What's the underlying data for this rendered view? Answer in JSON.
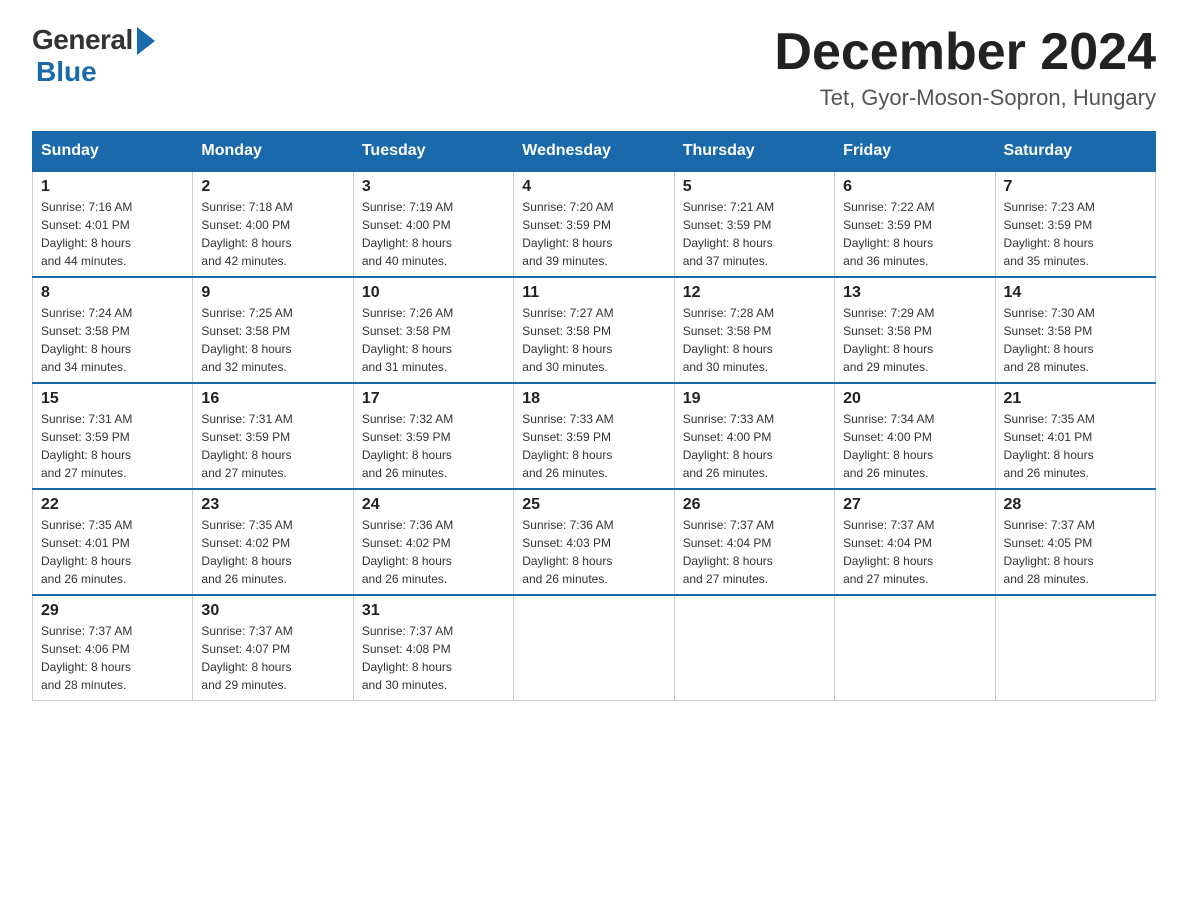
{
  "logo": {
    "general": "General",
    "blue": "Blue"
  },
  "header": {
    "month": "December 2024",
    "location": "Tet, Gyor-Moson-Sopron, Hungary"
  },
  "days_of_week": [
    "Sunday",
    "Monday",
    "Tuesday",
    "Wednesday",
    "Thursday",
    "Friday",
    "Saturday"
  ],
  "weeks": [
    [
      {
        "day": "1",
        "sunrise": "7:16 AM",
        "sunset": "4:01 PM",
        "daylight": "8 hours and 44 minutes."
      },
      {
        "day": "2",
        "sunrise": "7:18 AM",
        "sunset": "4:00 PM",
        "daylight": "8 hours and 42 minutes."
      },
      {
        "day": "3",
        "sunrise": "7:19 AM",
        "sunset": "4:00 PM",
        "daylight": "8 hours and 40 minutes."
      },
      {
        "day": "4",
        "sunrise": "7:20 AM",
        "sunset": "3:59 PM",
        "daylight": "8 hours and 39 minutes."
      },
      {
        "day": "5",
        "sunrise": "7:21 AM",
        "sunset": "3:59 PM",
        "daylight": "8 hours and 37 minutes."
      },
      {
        "day": "6",
        "sunrise": "7:22 AM",
        "sunset": "3:59 PM",
        "daylight": "8 hours and 36 minutes."
      },
      {
        "day": "7",
        "sunrise": "7:23 AM",
        "sunset": "3:59 PM",
        "daylight": "8 hours and 35 minutes."
      }
    ],
    [
      {
        "day": "8",
        "sunrise": "7:24 AM",
        "sunset": "3:58 PM",
        "daylight": "8 hours and 34 minutes."
      },
      {
        "day": "9",
        "sunrise": "7:25 AM",
        "sunset": "3:58 PM",
        "daylight": "8 hours and 32 minutes."
      },
      {
        "day": "10",
        "sunrise": "7:26 AM",
        "sunset": "3:58 PM",
        "daylight": "8 hours and 31 minutes."
      },
      {
        "day": "11",
        "sunrise": "7:27 AM",
        "sunset": "3:58 PM",
        "daylight": "8 hours and 30 minutes."
      },
      {
        "day": "12",
        "sunrise": "7:28 AM",
        "sunset": "3:58 PM",
        "daylight": "8 hours and 30 minutes."
      },
      {
        "day": "13",
        "sunrise": "7:29 AM",
        "sunset": "3:58 PM",
        "daylight": "8 hours and 29 minutes."
      },
      {
        "day": "14",
        "sunrise": "7:30 AM",
        "sunset": "3:58 PM",
        "daylight": "8 hours and 28 minutes."
      }
    ],
    [
      {
        "day": "15",
        "sunrise": "7:31 AM",
        "sunset": "3:59 PM",
        "daylight": "8 hours and 27 minutes."
      },
      {
        "day": "16",
        "sunrise": "7:31 AM",
        "sunset": "3:59 PM",
        "daylight": "8 hours and 27 minutes."
      },
      {
        "day": "17",
        "sunrise": "7:32 AM",
        "sunset": "3:59 PM",
        "daylight": "8 hours and 26 minutes."
      },
      {
        "day": "18",
        "sunrise": "7:33 AM",
        "sunset": "3:59 PM",
        "daylight": "8 hours and 26 minutes."
      },
      {
        "day": "19",
        "sunrise": "7:33 AM",
        "sunset": "4:00 PM",
        "daylight": "8 hours and 26 minutes."
      },
      {
        "day": "20",
        "sunrise": "7:34 AM",
        "sunset": "4:00 PM",
        "daylight": "8 hours and 26 minutes."
      },
      {
        "day": "21",
        "sunrise": "7:35 AM",
        "sunset": "4:01 PM",
        "daylight": "8 hours and 26 minutes."
      }
    ],
    [
      {
        "day": "22",
        "sunrise": "7:35 AM",
        "sunset": "4:01 PM",
        "daylight": "8 hours and 26 minutes."
      },
      {
        "day": "23",
        "sunrise": "7:35 AM",
        "sunset": "4:02 PM",
        "daylight": "8 hours and 26 minutes."
      },
      {
        "day": "24",
        "sunrise": "7:36 AM",
        "sunset": "4:02 PM",
        "daylight": "8 hours and 26 minutes."
      },
      {
        "day": "25",
        "sunrise": "7:36 AM",
        "sunset": "4:03 PM",
        "daylight": "8 hours and 26 minutes."
      },
      {
        "day": "26",
        "sunrise": "7:37 AM",
        "sunset": "4:04 PM",
        "daylight": "8 hours and 27 minutes."
      },
      {
        "day": "27",
        "sunrise": "7:37 AM",
        "sunset": "4:04 PM",
        "daylight": "8 hours and 27 minutes."
      },
      {
        "day": "28",
        "sunrise": "7:37 AM",
        "sunset": "4:05 PM",
        "daylight": "8 hours and 28 minutes."
      }
    ],
    [
      {
        "day": "29",
        "sunrise": "7:37 AM",
        "sunset": "4:06 PM",
        "daylight": "8 hours and 28 minutes."
      },
      {
        "day": "30",
        "sunrise": "7:37 AM",
        "sunset": "4:07 PM",
        "daylight": "8 hours and 29 minutes."
      },
      {
        "day": "31",
        "sunrise": "7:37 AM",
        "sunset": "4:08 PM",
        "daylight": "8 hours and 30 minutes."
      },
      null,
      null,
      null,
      null
    ]
  ]
}
